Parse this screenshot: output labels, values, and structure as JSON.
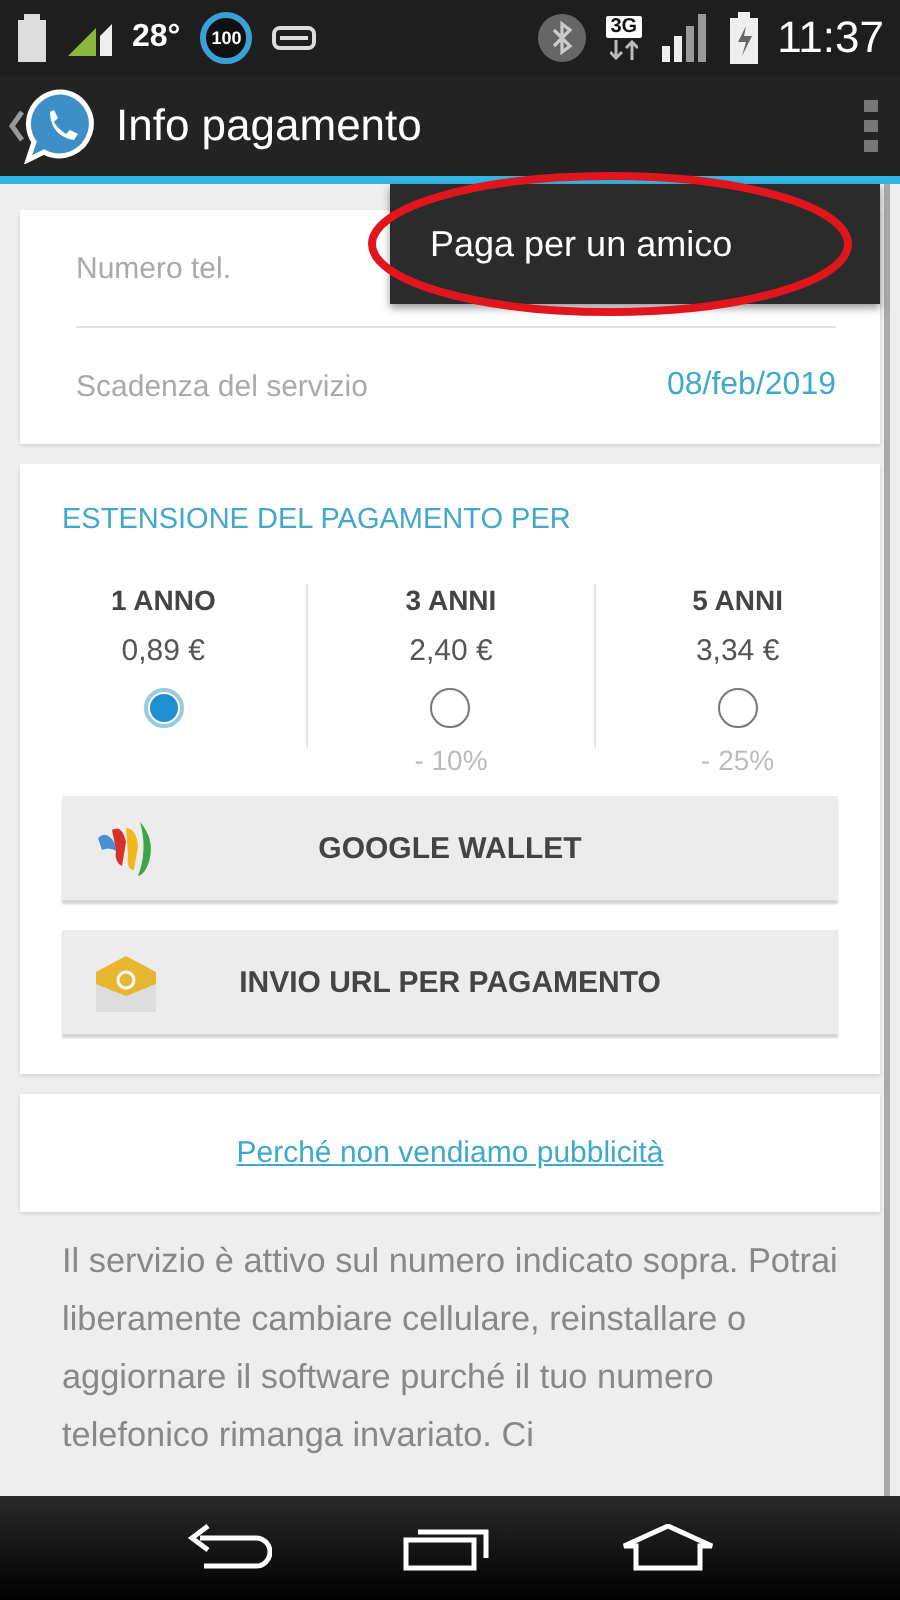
{
  "status_bar": {
    "temperature": "28°",
    "badge": "100",
    "network": "3G",
    "time": "11:37"
  },
  "action_bar": {
    "title": "Info pagamento"
  },
  "overflow_menu": {
    "items": [
      {
        "label": "Paga per un amico",
        "highlighted": true
      }
    ]
  },
  "info_card": {
    "rows": [
      {
        "label": "Numero tel."
      },
      {
        "label": "Scadenza del servizio",
        "value": "08/feb/2019"
      }
    ]
  },
  "payment_card": {
    "heading": "ESTENSIONE DEL PAGAMENTO PER",
    "options": [
      {
        "period": "1 ANNO",
        "price": "0,89 €",
        "selected": true
      },
      {
        "period": "3 ANNI",
        "price": "2,40 €",
        "selected": false,
        "discount": "- 10%"
      },
      {
        "period": "5 ANNI",
        "price": "3,34 €",
        "selected": false,
        "discount": "- 25%"
      }
    ],
    "buttons": [
      {
        "kind": "wallet",
        "label": "GOOGLE WALLET"
      },
      {
        "kind": "email",
        "label": "INVIO URL PER PAGAMENTO"
      }
    ]
  },
  "link_card": {
    "link": "Perché non vendiamo pubblicità"
  },
  "description": "Il servizio è attivo sul numero indicato sopra. Potrai liberamente cambiare cellulare, reinstallare o aggiornare il software purché il tuo numero telefonico rimanga invariato. Ci"
}
